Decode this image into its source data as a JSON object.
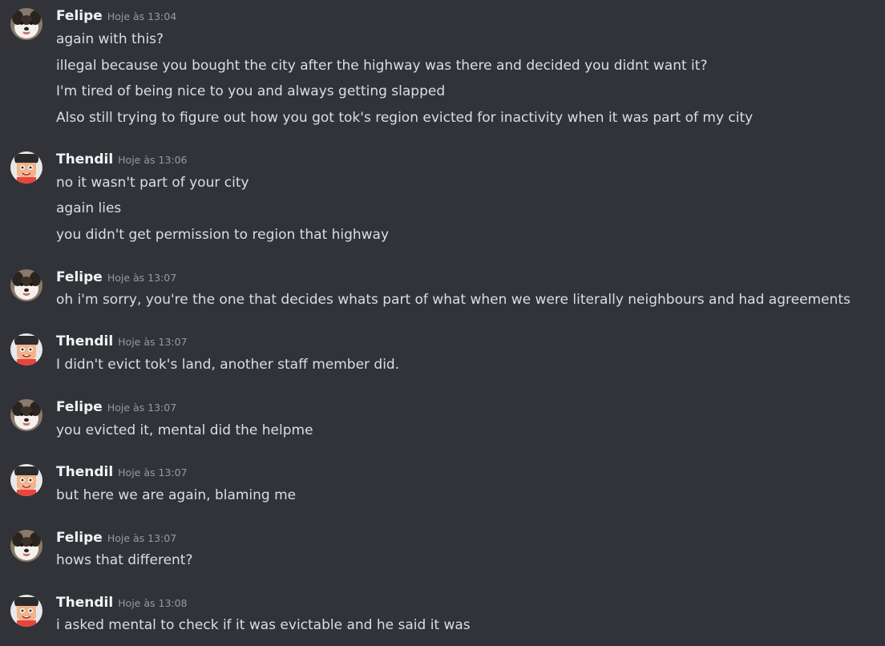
{
  "messages": [
    {
      "author": "Felipe",
      "timestamp": "Hoje às 13:04",
      "avatar_icon": "dog-avatar-icon",
      "lines": [
        "again with this?",
        "illegal because you bought the city after the highway was there and decided you didnt want it?",
        "I'm tired of being nice to you and always getting slapped",
        "Also still trying to figure out how you got tok's region evicted for inactivity when it was part of my city"
      ]
    },
    {
      "author": "Thendil",
      "timestamp": "Hoje às 13:06",
      "avatar_icon": "cartoon-boy-avatar-icon",
      "lines": [
        "no it wasn't part of your city",
        "again lies",
        "you didn't get permission to region that highway"
      ]
    },
    {
      "author": "Felipe",
      "timestamp": "Hoje às 13:07",
      "avatar_icon": "dog-avatar-icon",
      "lines": [
        "oh i'm sorry, you're the one that decides whats part of what when we were literally neighbours and had agreements"
      ]
    },
    {
      "author": "Thendil",
      "timestamp": "Hoje às 13:07",
      "avatar_icon": "cartoon-boy-avatar-icon",
      "lines": [
        "I didn't evict tok's land, another staff member did."
      ]
    },
    {
      "author": "Felipe",
      "timestamp": "Hoje às 13:07",
      "avatar_icon": "dog-avatar-icon",
      "lines": [
        "you evicted it, mental did the helpme"
      ]
    },
    {
      "author": "Thendil",
      "timestamp": "Hoje às 13:07",
      "avatar_icon": "cartoon-boy-avatar-icon",
      "lines": [
        "but here we are again, blaming me"
      ]
    },
    {
      "author": "Felipe",
      "timestamp": "Hoje às 13:07",
      "avatar_icon": "dog-avatar-icon",
      "lines": [
        "hows that different?"
      ]
    },
    {
      "author": "Thendil",
      "timestamp": "Hoje às 13:08",
      "avatar_icon": "cartoon-boy-avatar-icon",
      "lines": [
        "i asked mental to check if it was evictable and he said it was"
      ]
    }
  ],
  "colors": {
    "background": "#313338",
    "username": "#f2f3f5",
    "timestamp": "#949ba4",
    "message_text": "#dbdee1"
  }
}
